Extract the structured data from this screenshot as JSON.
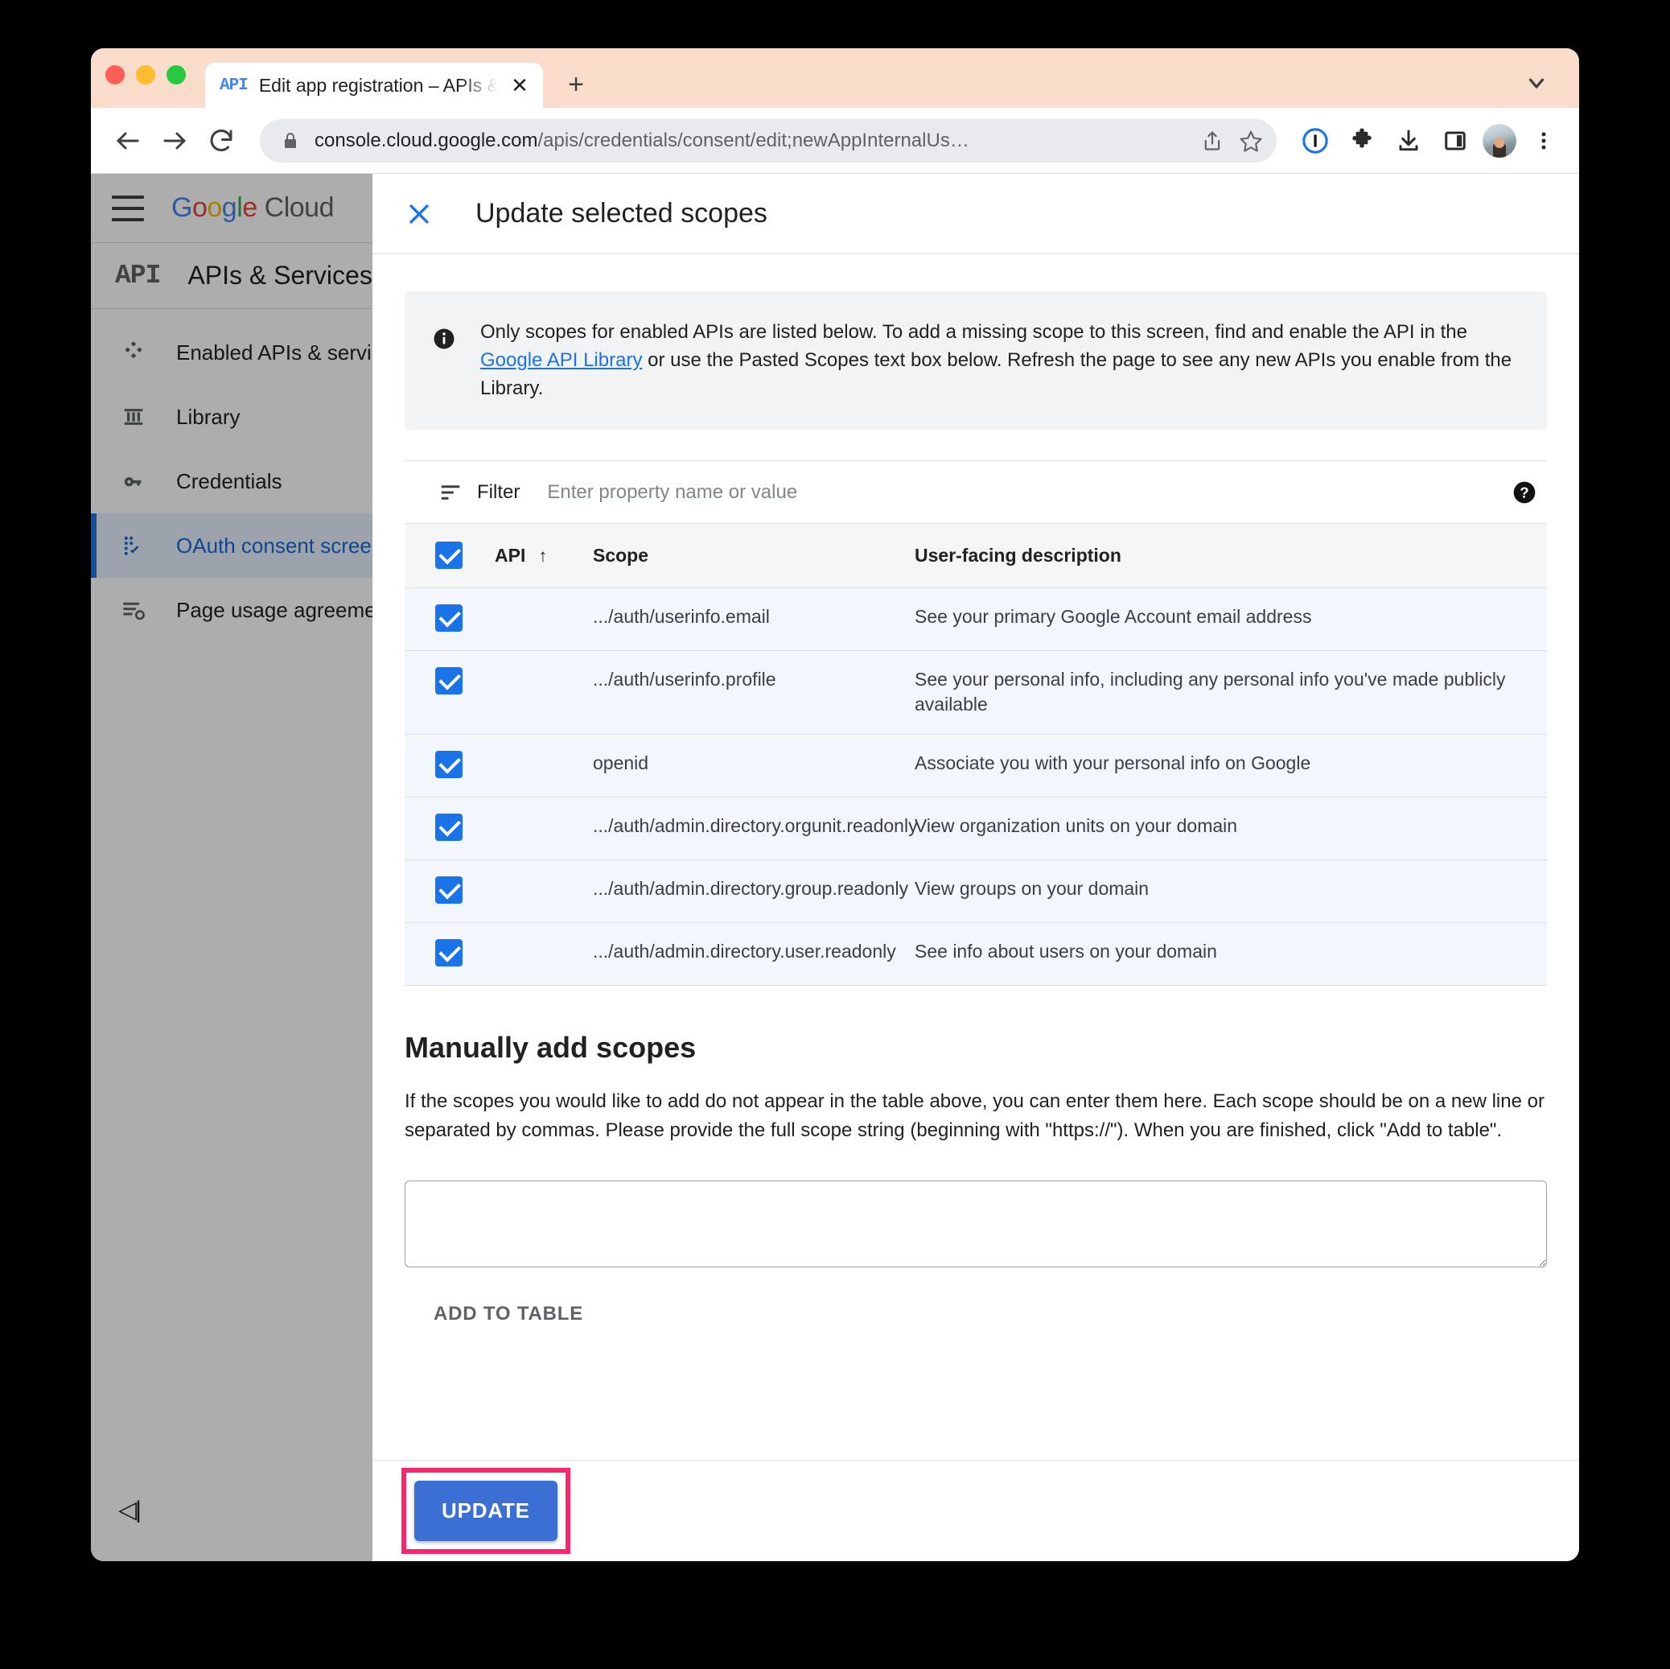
{
  "browser": {
    "tab": {
      "favicon_label": "API",
      "title": "Edit app registration – APIs & S",
      "close_label": "✕"
    },
    "new_tab_label": "+",
    "omnibox": {
      "host": "console.cloud.google.com",
      "path": "/apis/credentials/consent/edit;newAppInternalUs…"
    },
    "icons": {
      "back": "back-arrow-icon",
      "forward": "forward-arrow-icon",
      "reload": "reload-icon",
      "lock": "lock-icon",
      "share": "share-icon",
      "bookmark": "star-icon",
      "onepassword": "1password-icon",
      "extensions": "puzzle-icon",
      "downloads": "download-icon",
      "sidepanel": "side-panel-icon",
      "profile": "avatar",
      "menu": "kebab-menu-icon",
      "tabstrip_chevron": "chevron-down-icon"
    }
  },
  "console": {
    "logo": {
      "g1": "G",
      "o1": "o",
      "o2": "o",
      "g2": "g",
      "l": "l",
      "e": "e",
      "suffix": " Cloud"
    },
    "product": {
      "badge": "API",
      "title": "APIs & Services"
    },
    "nav_items": [
      {
        "label": "Enabled APIs & services",
        "icon": "dashboard-icon",
        "selected": false
      },
      {
        "label": "Library",
        "icon": "library-icon",
        "selected": false
      },
      {
        "label": "Credentials",
        "icon": "key-icon",
        "selected": false
      },
      {
        "label": "OAuth consent screen",
        "icon": "consent-screen-icon",
        "selected": true
      },
      {
        "label": "Page usage agreements",
        "icon": "agreements-icon",
        "selected": false
      }
    ],
    "collapse_label": "◁|"
  },
  "dialog": {
    "title": "Update selected scopes",
    "close_label": "✕",
    "info": {
      "text_before_link": "Only scopes for enabled APIs are listed below. To add a missing scope to this screen, find and enable the API in the ",
      "link_text": "Google API Library",
      "text_after_link": " or use the Pasted Scopes text box below. Refresh the page to see any new APIs you enable from the Library."
    },
    "filter": {
      "label": "Filter",
      "placeholder": "Enter property name or value",
      "value": ""
    },
    "table": {
      "columns": [
        "",
        "API",
        "Scope",
        "User-facing description"
      ],
      "sort_column": "API",
      "sort_arrow": "↑",
      "header_checked": true,
      "rows": [
        {
          "checked": true,
          "api": "",
          "scope": ".../auth/userinfo.email",
          "description": "See your primary Google Account email address"
        },
        {
          "checked": true,
          "api": "",
          "scope": ".../auth/userinfo.profile",
          "description": "See your personal info, including any personal info you've made publicly available"
        },
        {
          "checked": true,
          "api": "",
          "scope": "openid",
          "description": "Associate you with your personal info on Google"
        },
        {
          "checked": true,
          "api": "",
          "scope": ".../auth/admin.directory.orgunit.readonly",
          "description": "View organization units on your domain"
        },
        {
          "checked": true,
          "api": "",
          "scope": ".../auth/admin.directory.group.readonly",
          "description": "View groups on your domain"
        },
        {
          "checked": true,
          "api": "",
          "scope": ".../auth/admin.directory.user.readonly",
          "description": "See info about users on your domain"
        }
      ]
    },
    "manual": {
      "heading": "Manually add scopes",
      "description": "If the scopes you would like to add do not appear in the table above, you can enter them here. Each scope should be on a new line or separated by commas. Please provide the full scope string (beginning with \"https://\"). When you are finished, click \"Add to table\".",
      "textarea_value": "",
      "textarea_placeholder": "",
      "add_button_label": "ADD TO TABLE"
    },
    "footer": {
      "update_label": "UPDATE"
    }
  },
  "colors": {
    "accent_blue": "#1a73e8",
    "button_blue": "#3b6fd4",
    "highlight_pink": "#f5276e",
    "row_bg": "#f2f6fd",
    "tabstrip_bg": "#fadccb"
  }
}
